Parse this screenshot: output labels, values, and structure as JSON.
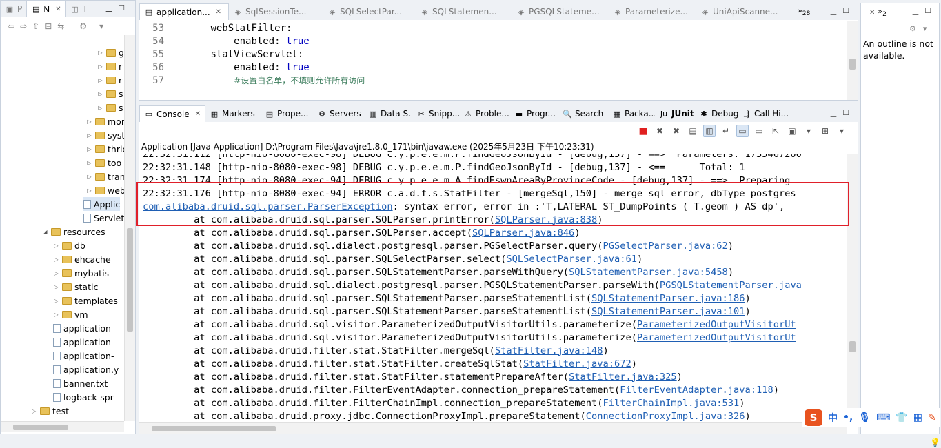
{
  "left_panel": {
    "tabs": [
      {
        "label": "P"
      },
      {
        "label": "N"
      },
      {
        "label": "T"
      }
    ],
    "tree": [
      {
        "label": "g",
        "indent": 5
      },
      {
        "label": "r",
        "indent": 5
      },
      {
        "label": "r",
        "indent": 5
      },
      {
        "label": "s",
        "indent": 5
      },
      {
        "label": "s",
        "indent": 5
      },
      {
        "label": "mor",
        "indent": 4
      },
      {
        "label": "syst",
        "indent": 4
      },
      {
        "label": "thric",
        "indent": 4
      },
      {
        "label": "too",
        "indent": 4
      },
      {
        "label": "tran",
        "indent": 4
      },
      {
        "label": "web",
        "indent": 4
      },
      {
        "label": "Applic",
        "indent": 3
      },
      {
        "label": "Servlet",
        "indent": 3
      },
      {
        "label": "resources",
        "indent": 1
      },
      {
        "label": "db",
        "indent": 2
      },
      {
        "label": "ehcache",
        "indent": 2
      },
      {
        "label": "mybatis",
        "indent": 2
      },
      {
        "label": "static",
        "indent": 2
      },
      {
        "label": "templates",
        "indent": 2
      },
      {
        "label": "vm",
        "indent": 2
      },
      {
        "label": "application-",
        "indent": 2
      },
      {
        "label": "application-",
        "indent": 2
      },
      {
        "label": "application-",
        "indent": 2
      },
      {
        "label": "application.y",
        "indent": 2
      },
      {
        "label": "banner.txt",
        "indent": 2
      },
      {
        "label": "logback-spr",
        "indent": 2
      },
      {
        "label": "test",
        "indent": 0
      }
    ]
  },
  "editor": {
    "tabs": [
      {
        "label": "application...",
        "active": true
      },
      {
        "label": "SqlSessionTe..."
      },
      {
        "label": "SQLSelectPar..."
      },
      {
        "label": "SQLStatemen..."
      },
      {
        "label": "PGSQLStateme..."
      },
      {
        "label": "Parameterize..."
      },
      {
        "label": "UniApiScanne..."
      }
    ],
    "overflow_count": "28",
    "lines": [
      {
        "num": "53",
        "indent": "        ",
        "key": "webStatFilter:",
        "val": "",
        "comment": ""
      },
      {
        "num": "54",
        "indent": "            ",
        "key": "enabled: ",
        "val": "true",
        "comment": ""
      },
      {
        "num": "55",
        "indent": "        ",
        "key": "statViewServlet:",
        "val": "",
        "comment": ""
      },
      {
        "num": "56",
        "indent": "            ",
        "key": "enabled: ",
        "val": "true",
        "comment": ""
      },
      {
        "num": "57",
        "indent": "            ",
        "key": "",
        "val": "",
        "comment": "#设置白名单，不填则允许所有访问"
      }
    ]
  },
  "outline": {
    "overflow_count": "2",
    "message": "An outline is not available."
  },
  "console": {
    "tabs": [
      {
        "label": "Console",
        "icon": "console-icon"
      },
      {
        "label": "Markers",
        "icon": "markers-icon"
      },
      {
        "label": "Prope...",
        "icon": "properties-icon"
      },
      {
        "label": "Servers",
        "icon": "servers-icon"
      },
      {
        "label": "Data S...",
        "icon": "data-source-icon"
      },
      {
        "label": "Snipp...",
        "icon": "snippets-icon"
      },
      {
        "label": "Proble...",
        "icon": "problems-icon"
      },
      {
        "label": "Progr...",
        "icon": "progress-icon"
      },
      {
        "label": "Search",
        "icon": "search-icon"
      },
      {
        "label": "Packa...",
        "icon": "package-icon"
      },
      {
        "label": "JUnit",
        "icon": "junit-icon"
      },
      {
        "label": "Debug",
        "icon": "debug-icon"
      },
      {
        "label": "Call Hi...",
        "icon": "call-hierarchy-icon"
      }
    ],
    "description": "Application [Java Application] D:\\Program Files\\Java\\jre1.8.0_171\\bin\\javaw.exe  (2025年5月23日 下午10:23:31)",
    "lines": [
      {
        "pre": "22:32:31.112 [http-nio-8080-exec-98] DEBUG c.y.p.e.e.m.P.findGeoJsonById - [debug,137] - ==>  Parameters: 1735467200",
        "link": "",
        "post": ""
      },
      {
        "pre": "22:32:31.148 [http-nio-8080-exec-98] DEBUG c.y.p.e.e.m.P.findGeoJsonById - [debug,137] - <==      Total: 1",
        "link": "",
        "post": ""
      },
      {
        "pre": "22:32:31.174 [http-nio-8080-exec-94] DEBUG c.y.p.e.e.m.A.findEswnAreaByProvinceCode - [debug,137] - ==>  Preparing",
        "link": "",
        "post": ""
      },
      {
        "pre": "22:32:31.176 [http-nio-8080-exec-94] ERROR c.a.d.f.s.StatFilter - [mergeSql,150] - merge sql error, dbType postgres",
        "link": "",
        "post": ""
      },
      {
        "pre": "",
        "link": "com.alibaba.druid.sql.parser.ParserException",
        "post": ": syntax error, error in :'T,LATERAL ST_DumpPoints ( T.geom ) AS dp',"
      },
      {
        "pre": "\tat com.alibaba.druid.sql.parser.SQLParser.printError(",
        "link": "SQLParser.java:838",
        "post": ")"
      },
      {
        "pre": "\tat com.alibaba.druid.sql.parser.SQLParser.accept(",
        "link": "SQLParser.java:846",
        "post": ")"
      },
      {
        "pre": "\tat com.alibaba.druid.sql.dialect.postgresql.parser.PGSelectParser.query(",
        "link": "PGSelectParser.java:62",
        "post": ")"
      },
      {
        "pre": "\tat com.alibaba.druid.sql.parser.SQLSelectParser.select(",
        "link": "SQLSelectParser.java:61",
        "post": ")"
      },
      {
        "pre": "\tat com.alibaba.druid.sql.parser.SQLStatementParser.parseWithQuery(",
        "link": "SQLStatementParser.java:5458",
        "post": ")"
      },
      {
        "pre": "\tat com.alibaba.druid.sql.dialect.postgresql.parser.PGSQLStatementParser.parseWith(",
        "link": "PGSQLStatementParser.java",
        "post": ""
      },
      {
        "pre": "\tat com.alibaba.druid.sql.parser.SQLStatementParser.parseStatementList(",
        "link": "SQLStatementParser.java:186",
        "post": ")"
      },
      {
        "pre": "\tat com.alibaba.druid.sql.parser.SQLStatementParser.parseStatementList(",
        "link": "SQLStatementParser.java:101",
        "post": ")"
      },
      {
        "pre": "\tat com.alibaba.druid.sql.visitor.ParameterizedOutputVisitorUtils.parameterize(",
        "link": "ParameterizedOutputVisitorUt",
        "post": ""
      },
      {
        "pre": "\tat com.alibaba.druid.sql.visitor.ParameterizedOutputVisitorUtils.parameterize(",
        "link": "ParameterizedOutputVisitorUt",
        "post": ""
      },
      {
        "pre": "\tat com.alibaba.druid.filter.stat.StatFilter.mergeSql(",
        "link": "StatFilter.java:148",
        "post": ")"
      },
      {
        "pre": "\tat com.alibaba.druid.filter.stat.StatFilter.createSqlStat(",
        "link": "StatFilter.java:672",
        "post": ")"
      },
      {
        "pre": "\tat com.alibaba.druid.filter.stat.StatFilter.statementPrepareAfter(",
        "link": "StatFilter.java:325",
        "post": ")"
      },
      {
        "pre": "\tat com.alibaba.druid.filter.FilterEventAdapter.connection_prepareStatement(",
        "link": "FilterEventAdapter.java:118",
        "post": ")"
      },
      {
        "pre": "\tat com.alibaba.druid.filter.FilterChainImpl.connection_prepareStatement(",
        "link": "FilterChainImpl.java:531",
        "post": ")"
      },
      {
        "pre": "\tat com.alibaba.druid.proxy.jdbc.ConnectionProxyImpl.prepareStatement(",
        "link": "ConnectionProxyImpl.java:326",
        "post": ")"
      }
    ]
  },
  "ime": {
    "logo": "S",
    "mode": "中",
    "punct": "•,",
    "icons": [
      "mic-icon",
      "keyboard-icon",
      "skin-icon",
      "toolbox-icon",
      "settings-icon"
    ]
  },
  "colors": {
    "error_highlight": "#e0202a",
    "link": "#1f5fb4",
    "keyword_value": "#0000c0",
    "comment": "#3f7f5f"
  }
}
